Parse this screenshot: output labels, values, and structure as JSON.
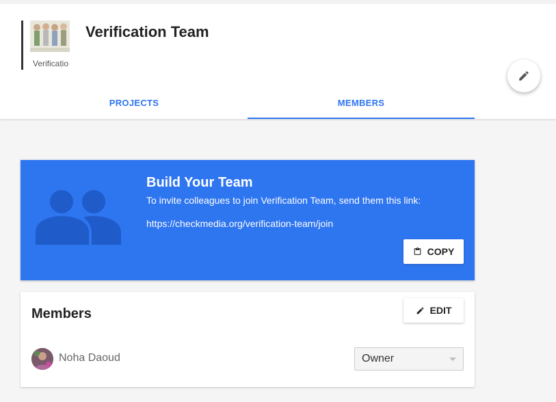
{
  "team": {
    "name": "Verification Team",
    "avatar_label": "Verificatio"
  },
  "tabs": [
    {
      "label": "PROJECTS",
      "active": false
    },
    {
      "label": "MEMBERS",
      "active": true
    }
  ],
  "build_card": {
    "title": "Build Your Team",
    "description": "To invite colleagues to join Verification Team, send them this link:",
    "link": "https://checkmedia.org/verification-team/join",
    "copy_label": "COPY",
    "icon": "group-icon"
  },
  "members": {
    "title": "Members",
    "edit_label": "EDIT",
    "list": [
      {
        "name": "Noha Daoud",
        "role": "Owner"
      }
    ]
  },
  "colors": {
    "accent": "#2e75f0",
    "background": "#f5f5f5"
  }
}
